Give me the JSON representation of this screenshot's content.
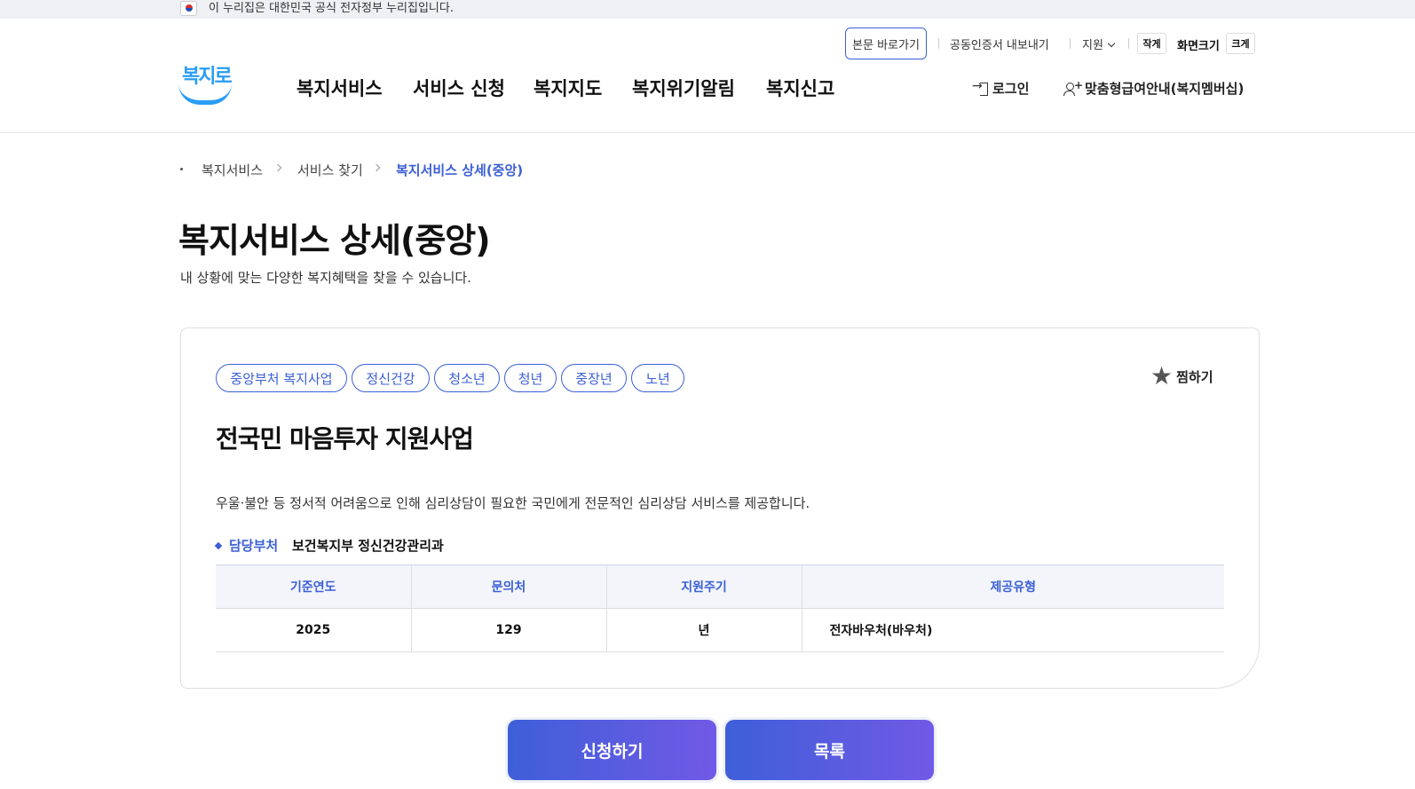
{
  "gov_banner": {
    "text": "이 누리집은 대한민국 공식 전자정부 누리집입니다."
  },
  "utility": {
    "skip_link": "본문 바로가기",
    "cert_export": "공동인증서 내보내기",
    "support": "지원",
    "font_small": "작게",
    "screen_size": "화면크기",
    "font_large": "크게"
  },
  "header": {
    "logo": "복지로",
    "nav": [
      "복지서비스",
      "서비스 신청",
      "복지지도",
      "복지위기알림",
      "복지신고"
    ],
    "login": "로그인",
    "membership": "맞춤형급여안내(복지멤버십)"
  },
  "breadcrumb": [
    "복지서비스",
    "서비스 찾기",
    "복지서비스 상세(중앙)"
  ],
  "page": {
    "title": "복지서비스 상세(중앙)",
    "subtitle": "내 상황에 맞는 다양한 복지혜택을 찾을 수 있습니다."
  },
  "service": {
    "tags": [
      "중앙부처 복지사업",
      "정신건강",
      "청소년",
      "청년",
      "중장년",
      "노년"
    ],
    "favorite": "찜하기",
    "title": "전국민 마음투자 지원사업",
    "description": "우울·불안 등 정서적 어려움으로 인해 심리상담이 필요한 국민에게 전문적인 심리상담 서비스를 제공합니다.",
    "dept_label": "담당부처",
    "dept_value": "보건복지부 정신건강관리과",
    "table": {
      "headers": [
        "기준연도",
        "문의처",
        "지원주기",
        "제공유형"
      ],
      "row": [
        "2025",
        "129",
        "년",
        "전자바우처(바우처)"
      ]
    }
  },
  "actions": {
    "apply": "신청하기",
    "list": "목록"
  },
  "colors": {
    "accent": "#3b5fd6",
    "logo": "#2a9df4",
    "button_gradient_end": "#7159e6"
  }
}
